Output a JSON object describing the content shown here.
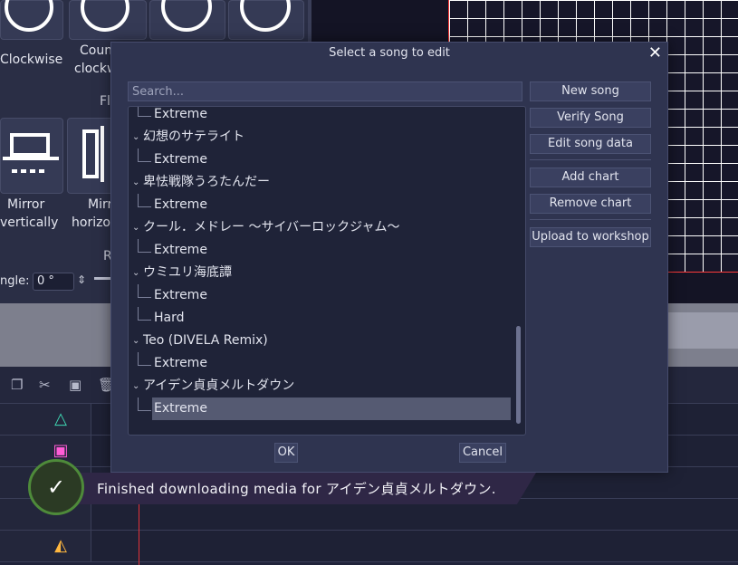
{
  "background": {
    "tools": {
      "clockwise_label": "Clockwise",
      "counter_label_1": "Count",
      "counter_label_2": "clockw",
      "flip_section": "Fli",
      "mirror_v_label_1": "Mirror",
      "mirror_v_label_2": "vertically",
      "mirror_h_label_1": "Mirr",
      "mirror_h_label_2": "horizon",
      "rotate_section": "R",
      "angle_label": "ngle:",
      "angle_value": "0 °"
    }
  },
  "dialog": {
    "title": "Select a song to edit",
    "search_placeholder": "Search...",
    "tree": [
      {
        "type": "child",
        "label": "Extreme"
      },
      {
        "type": "parent",
        "label": "幻想のサテライト"
      },
      {
        "type": "child",
        "label": "Extreme"
      },
      {
        "type": "parent",
        "label": "卑怯戦隊うろたんだー"
      },
      {
        "type": "child",
        "label": "Extreme"
      },
      {
        "type": "parent",
        "label": "クール．メドレー ～サイバーロックジャム～"
      },
      {
        "type": "child",
        "label": "Extreme"
      },
      {
        "type": "parent",
        "label": "ウミユリ海底譚"
      },
      {
        "type": "child",
        "label": "Extreme"
      },
      {
        "type": "child",
        "label": "Hard"
      },
      {
        "type": "parent",
        "label": "Teo (DIVELA Remix)"
      },
      {
        "type": "child",
        "label": "Extreme"
      },
      {
        "type": "parent",
        "label": "アイデン貞貞メルトダウン"
      },
      {
        "type": "child",
        "label": "Extreme",
        "selected": true
      }
    ],
    "buttons": {
      "new_song": "New song",
      "verify_song": "Verify Song",
      "edit_song_data": "Edit song data",
      "add_chart": "Add chart",
      "remove_chart": "Remove chart",
      "upload": "Upload to workshop",
      "ok": "OK",
      "cancel": "Cancel"
    }
  },
  "toast": {
    "message": "Finished downloading media for アイデン貞貞メルトダウン."
  },
  "colors": {
    "accent_red": "#e2333a",
    "toast_green": "#4e8a3a",
    "dialog_bg": "#2f3450"
  }
}
